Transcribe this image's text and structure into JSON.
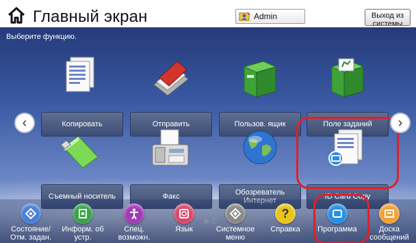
{
  "header": {
    "title": "Главный экран",
    "user": "Admin",
    "logout_label": "Выход из системы"
  },
  "main": {
    "subtitle": "Выберите функцию.",
    "tiles": [
      {
        "label": "Копировать",
        "icon": "copy-icon"
      },
      {
        "label": "Отправить",
        "icon": "send-icon"
      },
      {
        "label": "Пользов. ящик",
        "icon": "user-box-icon"
      },
      {
        "label": "Поле заданий",
        "icon": "job-box-icon"
      },
      {
        "label": "Съемный носитель",
        "icon": "usb-drive-icon"
      },
      {
        "label": "Факс",
        "icon": "fax-icon"
      },
      {
        "label": "Обозреватель Интернет",
        "icon": "globe-icon"
      },
      {
        "label": "ID Card Copy",
        "icon": "id-card-copy-icon"
      }
    ],
    "page_indicator": {
      "pages": 2,
      "current": 1
    }
  },
  "bottom_bar": {
    "items": [
      {
        "label": "Состояние/ Отм. задан.",
        "icon": "status-icon",
        "color": "#4a7fd6"
      },
      {
        "label": "Информ. об устр.",
        "icon": "device-info-icon",
        "color": "#3aa34a"
      },
      {
        "label": "Спец. возможн.",
        "icon": "accessibility-icon",
        "color": "#a23bb8"
      },
      {
        "label": "Язык",
        "icon": "language-icon",
        "color": "#d94a6a"
      },
      {
        "label": "Системное меню",
        "icon": "system-menu-icon",
        "color": "#8a8a8a"
      },
      {
        "label": "Справка",
        "icon": "help-icon",
        "color": "#e8c51c"
      },
      {
        "label": "Программа",
        "icon": "program-icon",
        "color": "#2b8fe0"
      },
      {
        "label": "Доска сообщений",
        "icon": "message-board-icon",
        "color": "#f0a23a"
      }
    ]
  },
  "colors": {
    "highlight": "#e0202a",
    "tile_label_bg": "#4b5b80"
  }
}
